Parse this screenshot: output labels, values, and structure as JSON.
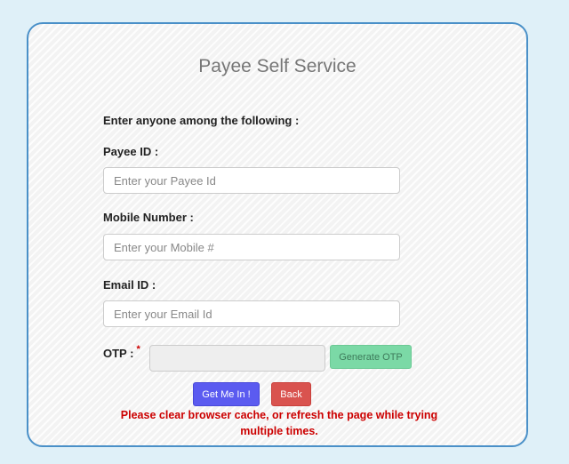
{
  "form": {
    "title": "Payee Self Service",
    "instruction": "Enter anyone among the following :",
    "payee_id": {
      "label": "Payee ID :",
      "value": "",
      "placeholder": "Enter your Payee Id"
    },
    "mobile": {
      "label": "Mobile Number :",
      "value": "",
      "placeholder": "Enter your Mobile #"
    },
    "email": {
      "label": "Email ID :",
      "value": "",
      "placeholder": "Enter your Email Id"
    },
    "otp": {
      "label": "OTP :",
      "required_marker": "*",
      "value": "",
      "generate_label": "Generate OTP"
    },
    "login_label": "Get Me In !",
    "back_label": "Back",
    "warning": "Please clear browser cache, or refresh the page while trying multiple times."
  },
  "colors": {
    "page_background": "#dff0f8",
    "panel_border": "#4a90c8",
    "generate_otp_button": "#7bd9a6",
    "login_button": "#5b5bf0",
    "back_button": "#d9534f",
    "warning_text": "#cc0000"
  }
}
